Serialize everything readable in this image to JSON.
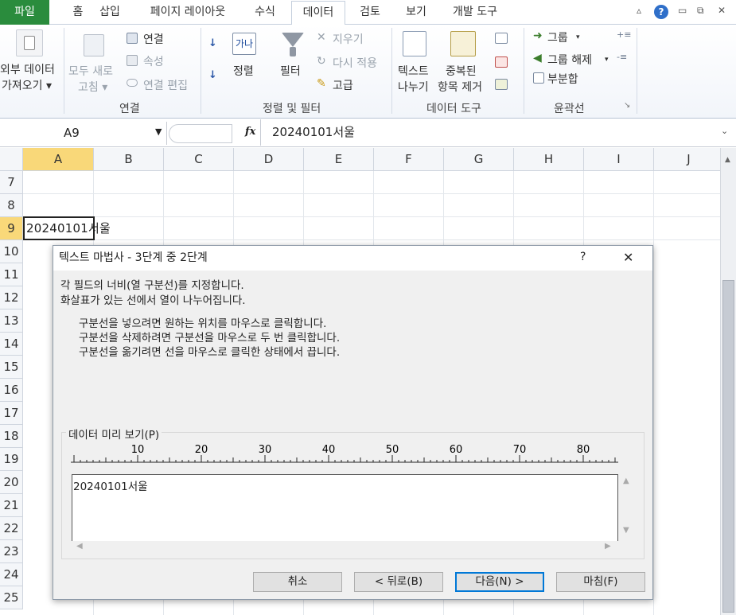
{
  "tabs": [
    "파일",
    "홈",
    "삽입",
    "페이지 레이아웃",
    "수식",
    "데이터",
    "검토",
    "보기",
    "개발 도구"
  ],
  "ribbon": {
    "external_data": [
      "외부 데이터",
      "가져오기 ▾"
    ],
    "refresh_all": [
      "모두 새로",
      "고침 ▾"
    ],
    "connections": "연결",
    "properties": "속성",
    "edit_links": "연결 편집",
    "group_connections": "연결",
    "sort": "정렬",
    "sort_icon": "가나",
    "filter": "필터",
    "clear": "지우기",
    "reapply": "다시 적용",
    "advanced": "고급",
    "group_sort_filter": "정렬 및 필터",
    "text_to_columns": [
      "텍스트",
      "나누기"
    ],
    "remove_duplicates": [
      "중복된",
      "항목 제거"
    ],
    "group_data_tools": "데이터 도구",
    "group_btn": "그룹",
    "ungroup_btn": "그룹 해제",
    "subtotal": "부분합",
    "group_outline": "윤곽선"
  },
  "formula_bar": {
    "name_box": "A9",
    "fx": "fx",
    "formula": "20240101서울"
  },
  "sheet": {
    "columns": [
      "A",
      "B",
      "C",
      "D",
      "E",
      "F",
      "G",
      "H",
      "I",
      "J"
    ],
    "rows": [
      "7",
      "8",
      "9",
      "10",
      "11",
      "12",
      "13",
      "14",
      "15",
      "16",
      "17",
      "18",
      "19",
      "20",
      "21",
      "22",
      "23",
      "24",
      "25"
    ],
    "cell_a9": "20240101서울"
  },
  "dialog": {
    "title": "텍스트 마법사 - 3단계 중 2단계",
    "help": "?",
    "close": "✕",
    "line1": "각 필드의 너비(열 구분선)를 지정합니다.",
    "line2": "화살표가 있는 선에서 열이 나누어집니다.",
    "inst1": "구분선을 넣으려면 원하는 위치를 마우스로 클릭합니다.",
    "inst2": "구분선을 삭제하려면 구분선을 마우스로 두 번 클릭합니다.",
    "inst3": "구분선을 옮기려면 선을 마우스로 클릭한 상태에서 끕니다.",
    "preview_label": "데이터 미리 보기(P)",
    "ruler_labels": [
      "10",
      "20",
      "30",
      "40",
      "50",
      "60",
      "70",
      "80"
    ],
    "preview_text": "20240101서울",
    "cancel": "취소",
    "back": "< 뒤로(B)",
    "next": "다음(N) >",
    "finish": "마침(F)"
  }
}
